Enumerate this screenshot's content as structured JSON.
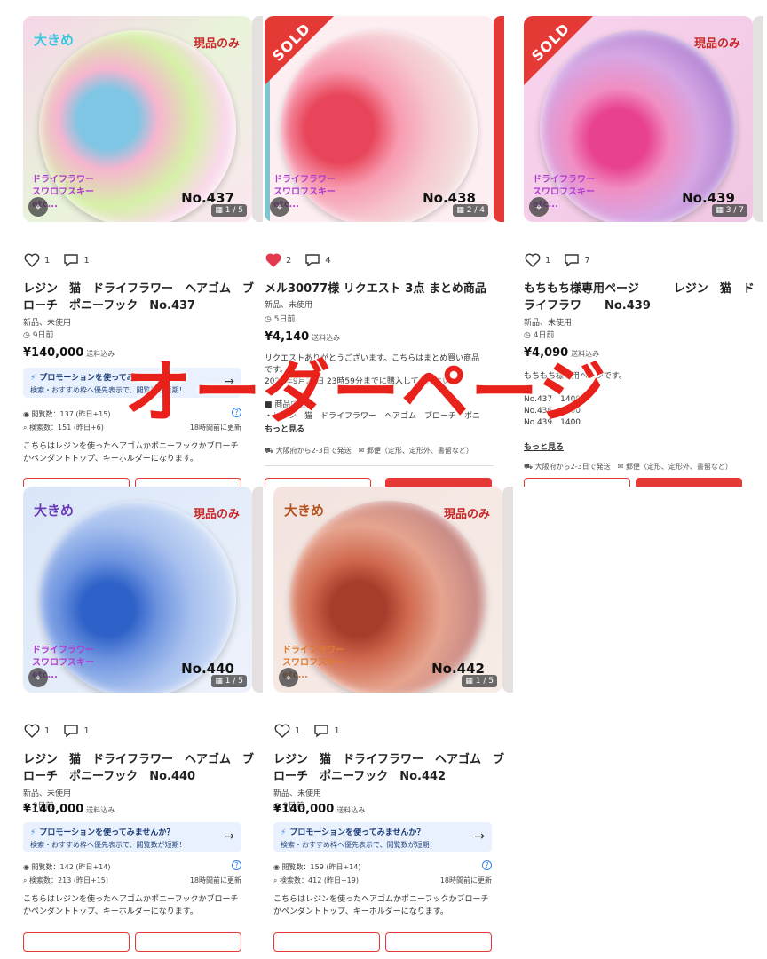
{
  "overlay_text": "オーダーページ",
  "products": [
    {
      "big_label": "大きめ",
      "genpin": "現品のみ",
      "dry_lines": [
        "ドライフラワー",
        "スワロフスキー",
        "etc..."
      ],
      "number_label": "No.437",
      "photo_count": "1 / 5",
      "likes": "1",
      "comments": "1",
      "liked": false,
      "title": "レジン　猫　ドライフラワー　ヘアゴム　ブローチ　ポニーフック　No.437",
      "condition": "新品、未使用",
      "time_ago": "9日前",
      "price": "¥140,000",
      "price_note": "送料込み",
      "promo_title": "プロモーションを使ってみませんか？",
      "promo_sub": "検索・おすすめ枠へ優先表示で、閲覧数が短期！",
      "views": "閲覧数：137 (昨日+15)",
      "favs": "検索数：151 (昨日+6)",
      "updated": "18時間前に更新",
      "description": "こちらはレジンを使ったヘアゴムかポニーフックかブローチかペンダントトップ、キーホルダーになります。"
    },
    {
      "sold": "SOLD",
      "genpin": "",
      "dry_lines": [
        "ドライフラワー",
        "スワロフスキー",
        "etc..."
      ],
      "number_label": "No.438",
      "photo_count": "2 / 4",
      "likes": "2",
      "comments": "4",
      "liked": true,
      "title": "メル30077様 リクエスト 3点 まとめ商品",
      "condition": "新品、未使用",
      "time_ago": "5日前",
      "price": "¥4,140",
      "price_note": "送料込み",
      "request_lines": [
        "リクエストありがとうございます。こちらはまとめ買い商品です。",
        "2025年9月24日 23時59分までに購入してください。"
      ],
      "item_heading": "■ 商品内容",
      "item_line": "・レジン　猫　ドライフラワー　ヘアゴム　ブローチ　ポニー",
      "more": "もっと見る",
      "ship_from": "大阪府から2-3日で発送",
      "ship_method": "郵便（定形、定形外、書留など）"
    },
    {
      "sold": "SOLD",
      "genpin": "現品のみ",
      "dry_lines": [
        "ドライフラワー",
        "スワロフスキー",
        "etc..."
      ],
      "number_label": "No.439",
      "photo_count": "3 / 7",
      "likes": "1",
      "comments": "7",
      "liked": false,
      "title": "もちもち様専用ページ　　　レジン　猫　ドライフラワ　　No.439",
      "condition": "新品、未使用",
      "time_ago": "4日前",
      "price": "¥4,090",
      "price_note": "送料込み",
      "request_lines": [
        "もちもち様専用ページです。"
      ],
      "list_lines": [
        "No.437　1400",
        "No.436　1400",
        "No.439　1400"
      ],
      "more": "もっと見る",
      "ship_from": "大阪府から2-3日で発送",
      "ship_method": "郵便（定形、定形外、書留など）"
    },
    {
      "big_label": "大きめ",
      "genpin": "現品のみ",
      "dry_lines": [
        "ドライフラワー",
        "スワロフスキー",
        "etc..."
      ],
      "number_label": "No.440",
      "photo_count": "1 / 5",
      "likes": "1",
      "comments": "1",
      "liked": false,
      "title": "レジン　猫　ドライフラワー　ヘアゴム　ブローチ　ポニーフック　No.440",
      "condition": "新品、未使用",
      "time_ago": "9日前",
      "price": "¥140,000",
      "price_note": "送料込み",
      "promo_title": "プロモーションを使ってみませんか？",
      "promo_sub": "検索・おすすめ枠へ優先表示で、閲覧数が短期！",
      "views": "閲覧数：142 (昨日+14)",
      "favs": "検索数：213 (昨日+15)",
      "updated": "18時間前に更新",
      "description": "こちらはレジンを使ったヘアゴムかポニーフックかブローチかペンダントトップ、キーホルダーになります。"
    },
    {
      "big_label": "大きめ",
      "genpin": "現品のみ",
      "dry_lines": [
        "ドライフラワー",
        "スワロフスキー",
        "etc..."
      ],
      "number_label": "No.442",
      "photo_count": "1 / 5",
      "likes": "1",
      "comments": "1",
      "liked": false,
      "title": "レジン　猫　ドライフラワー　ヘアゴム　ブローチ　ポニーフック　No.442",
      "condition": "新品、未使用",
      "time_ago": "9日前",
      "price": "¥140,000",
      "price_note": "送料込み",
      "promo_title": "プロモーションを使ってみませんか？",
      "promo_sub": "検索・おすすめ枠へ優先表示で、閲覧数が短期！",
      "views": "閲覧数：159 (昨日+14)",
      "favs": "検索数：412 (昨日+19)",
      "updated": "18時間前に更新",
      "description": "こちらはレジンを使ったヘアゴムかポニーフックかブローチかペンダントトップ、キーホルダーになります。"
    }
  ],
  "colors": {
    "accent_red": "#e53935",
    "heart_red": "#e53950",
    "promo_bg": "#e8f1fd",
    "promo_blue": "#2f80ed"
  }
}
